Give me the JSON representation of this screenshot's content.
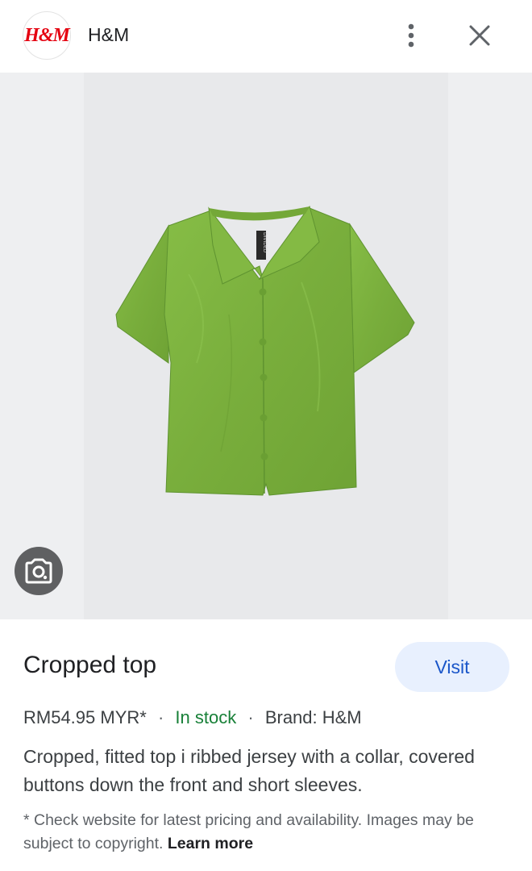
{
  "header": {
    "logo_text": "H&M",
    "brand_name": "H&M",
    "brand_color": "#e50010"
  },
  "image": {
    "alt": "",
    "neck_label": "DIVIDED",
    "garment_color": "#7db33f"
  },
  "product": {
    "title": "Cropped top",
    "visit_label": "Visit",
    "price": "RM54.95 MYR*",
    "stock": "In stock",
    "brand": "Brand: H&M",
    "separator": "·",
    "description": "Cropped, fitted top i ribbed jersey with a collar, covered buttons down the front and short sleeves.",
    "disclaimer": "* Check website for latest pricing and availability. Images may be subject to copyright.",
    "learn_more": "Learn more"
  },
  "icons": {
    "more": "more-vert-icon",
    "close": "close-icon",
    "lens": "google-lens-icon"
  }
}
